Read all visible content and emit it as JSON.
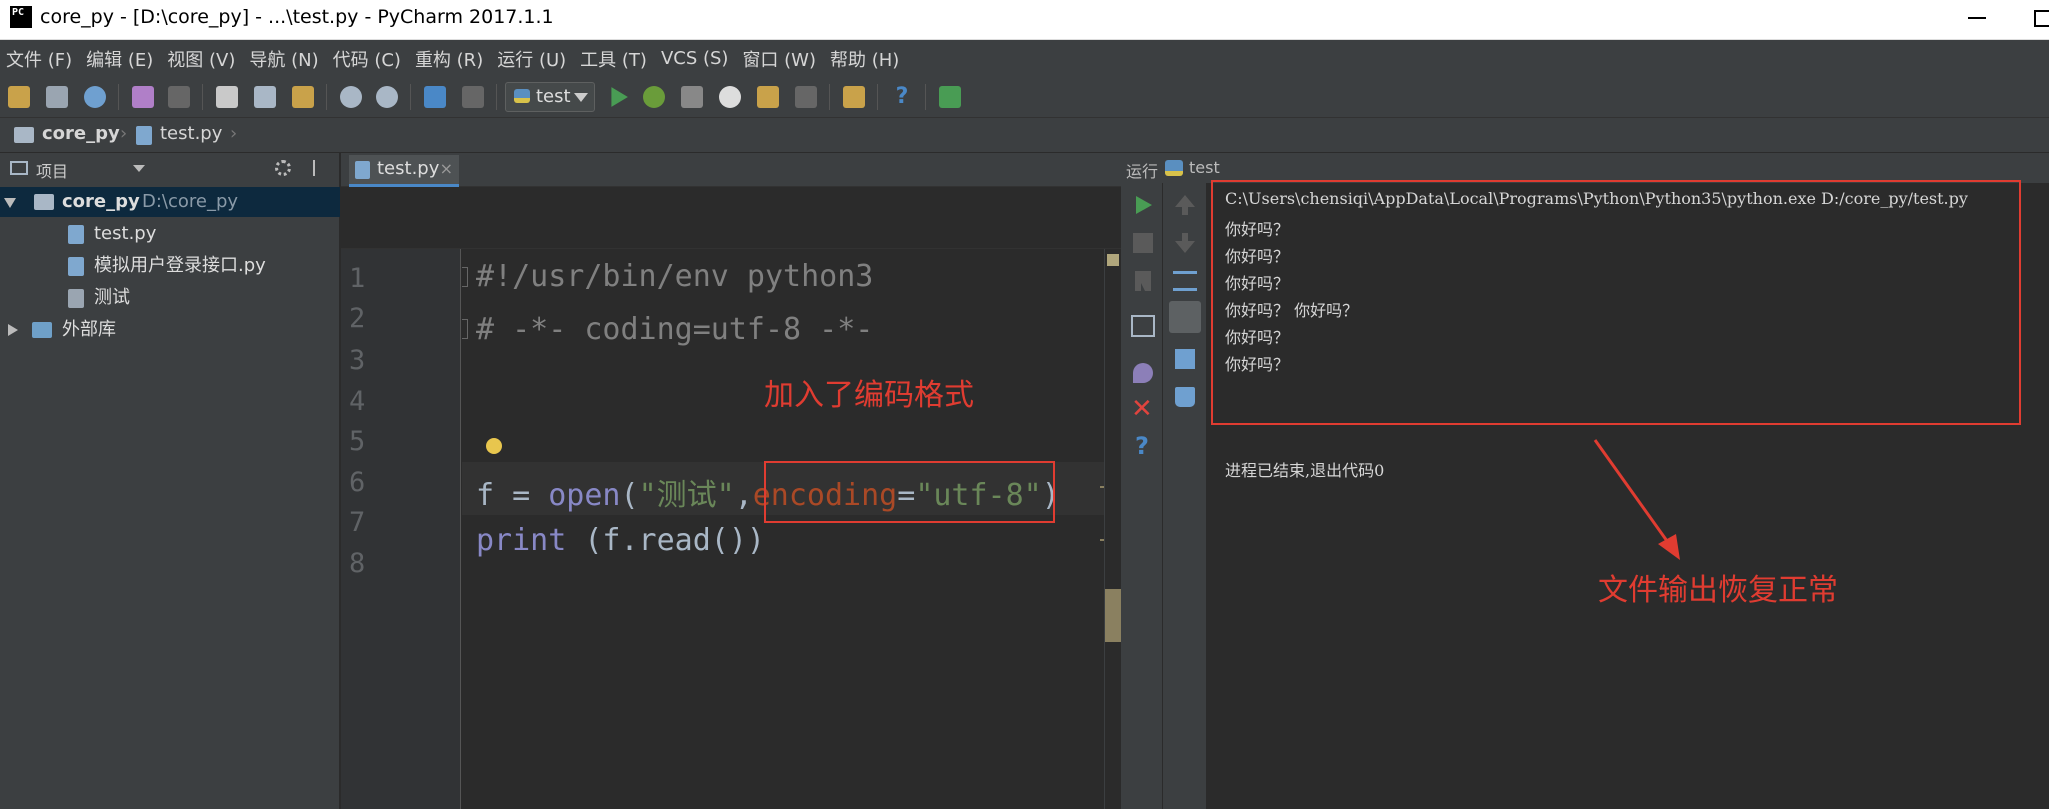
{
  "window": {
    "title": "core_py - [D:\\core_py] - ...\\test.py - PyCharm 2017.1.1",
    "logo": "PC"
  },
  "menu": [
    "文件 (F)",
    "编辑 (E)",
    "视图 (V)",
    "导航 (N)",
    "代码 (C)",
    "重构 (R)",
    "运行 (U)",
    "工具 (T)",
    "VCS (S)",
    "窗口 (W)",
    "帮助 (H)"
  ],
  "toolbar": {
    "run_config": "test",
    "icons": [
      "open-folder-icon",
      "save-icon",
      "sync-icon",
      "undo-icon",
      "redo-icon",
      "cut-icon",
      "copy-icon",
      "paste-icon",
      "find-icon",
      "replace-icon",
      "back-icon",
      "forward-icon",
      "run-icon",
      "debug-icon",
      "coverage-icon",
      "profile-icon",
      "run-with-icon",
      "stop-icon",
      "settings-icon",
      "help-icon",
      "structure-icon"
    ]
  },
  "breadcrumb": {
    "project": "core_py",
    "file": "test.py"
  },
  "project_panel": {
    "title": "项目",
    "root": {
      "name": "core_py",
      "path": "D:\\core_py"
    },
    "children": [
      "test.py",
      "模拟用户登录接口.py",
      "测试"
    ],
    "external": "外部库"
  },
  "editor": {
    "tab": "test.py",
    "line_numbers": [
      "1",
      "2",
      "3",
      "4",
      "5",
      "6",
      "7",
      "8"
    ],
    "line1": "#!/usr/bin/env python3",
    "line2": "# -*- coding=utf-8 -*-",
    "line5": {
      "var": "f",
      "eq": " = ",
      "func": "open",
      "open_paren": "(",
      "arg1": "\"测试\"",
      "comma": ",",
      "kwarg": "encoding",
      "kweq": "=",
      "kwval": "\"utf-8\"",
      "close_paren": ")"
    },
    "line6": {
      "func": "print",
      "rest": " (f.read())"
    },
    "annotation": "加入了编码格式"
  },
  "run_panel": {
    "label": "运行",
    "config": "test",
    "output": [
      "C:\\Users\\chensiqi\\AppData\\Local\\Programs\\Python\\Python35\\python.exe D:/core_py/test.py",
      "你好吗？",
      "你好吗？",
      "你好吗？",
      "你好吗？ 你好吗？",
      "你好吗？",
      "你好吗？"
    ],
    "exit_message": "进程已结束,退出代码0",
    "annotation": "文件输出恢复正常"
  },
  "colors": {
    "annotation_red": "#e03c31",
    "editor_bg": "#2b2b2b",
    "panel_bg": "#3c3f41",
    "string_green": "#6a8759",
    "keyword_orange": "#aa4926"
  }
}
